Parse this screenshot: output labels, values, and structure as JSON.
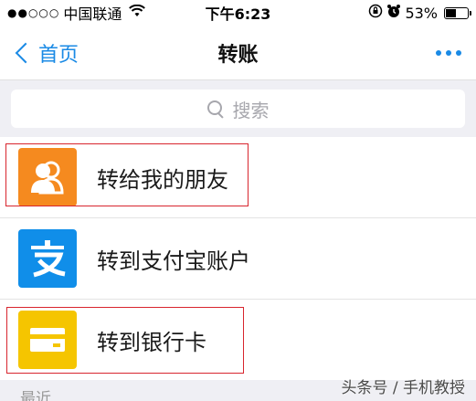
{
  "status_bar": {
    "signal": "●●○○○",
    "carrier": "中国联通",
    "time": "下午6:23",
    "battery": "53%",
    "battery_level": 0.53
  },
  "nav": {
    "back_label": "首页",
    "title": "转账"
  },
  "search": {
    "placeholder": "搜索"
  },
  "transfer_options": [
    {
      "label": "转给我的朋友"
    },
    {
      "label": "转到支付宝账户"
    },
    {
      "label": "转到银行卡"
    }
  ],
  "section": {
    "recent_label": "最近"
  },
  "watermark": "头条号 / 手机教授",
  "colors": {
    "accent": "#1a8ae5",
    "friends_icon_bg": "#f58a1f",
    "alipay_icon_bg": "#108ee9",
    "card_icon_bg": "#f5c500",
    "highlight": "#d8252e"
  },
  "icons": [
    "friends-icon",
    "alipay-icon",
    "bank-card-icon",
    "search-icon",
    "more-icon",
    "back-chevron-icon"
  ]
}
